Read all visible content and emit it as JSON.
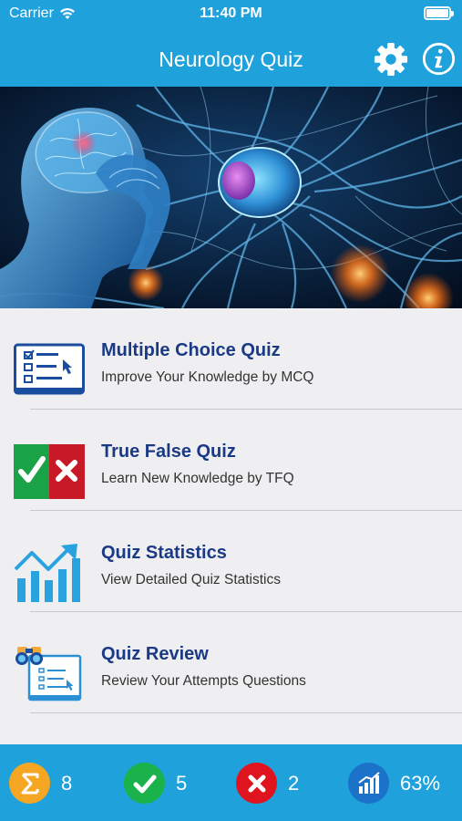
{
  "status_bar": {
    "carrier": "Carrier",
    "time": "11:40 PM"
  },
  "nav": {
    "title": "Neurology Quiz",
    "settings_icon": "gear-icon",
    "info_icon": "info-icon"
  },
  "menu": {
    "items": [
      {
        "title": "Multiple Choice Quiz",
        "subtitle": "Improve Your Knowledge by MCQ",
        "icon": "checklist-icon"
      },
      {
        "title": "True False Quiz",
        "subtitle": "Learn New Knowledge by TFQ",
        "icon": "true-false-icon"
      },
      {
        "title": "Quiz Statistics",
        "subtitle": "View Detailed Quiz Statistics",
        "icon": "chart-icon"
      },
      {
        "title": "Quiz Review",
        "subtitle": "Review Your Attempts Questions",
        "icon": "review-icon"
      }
    ]
  },
  "stats": {
    "total": "8",
    "correct": "5",
    "wrong": "2",
    "percent": "63%"
  },
  "colors": {
    "brand": "#1fa2dc",
    "title_text": "#1a3a86",
    "sum_badge": "#f5a623",
    "correct_badge": "#19b24b",
    "wrong_badge": "#e0141e",
    "percent_badge": "#1b72c9"
  }
}
